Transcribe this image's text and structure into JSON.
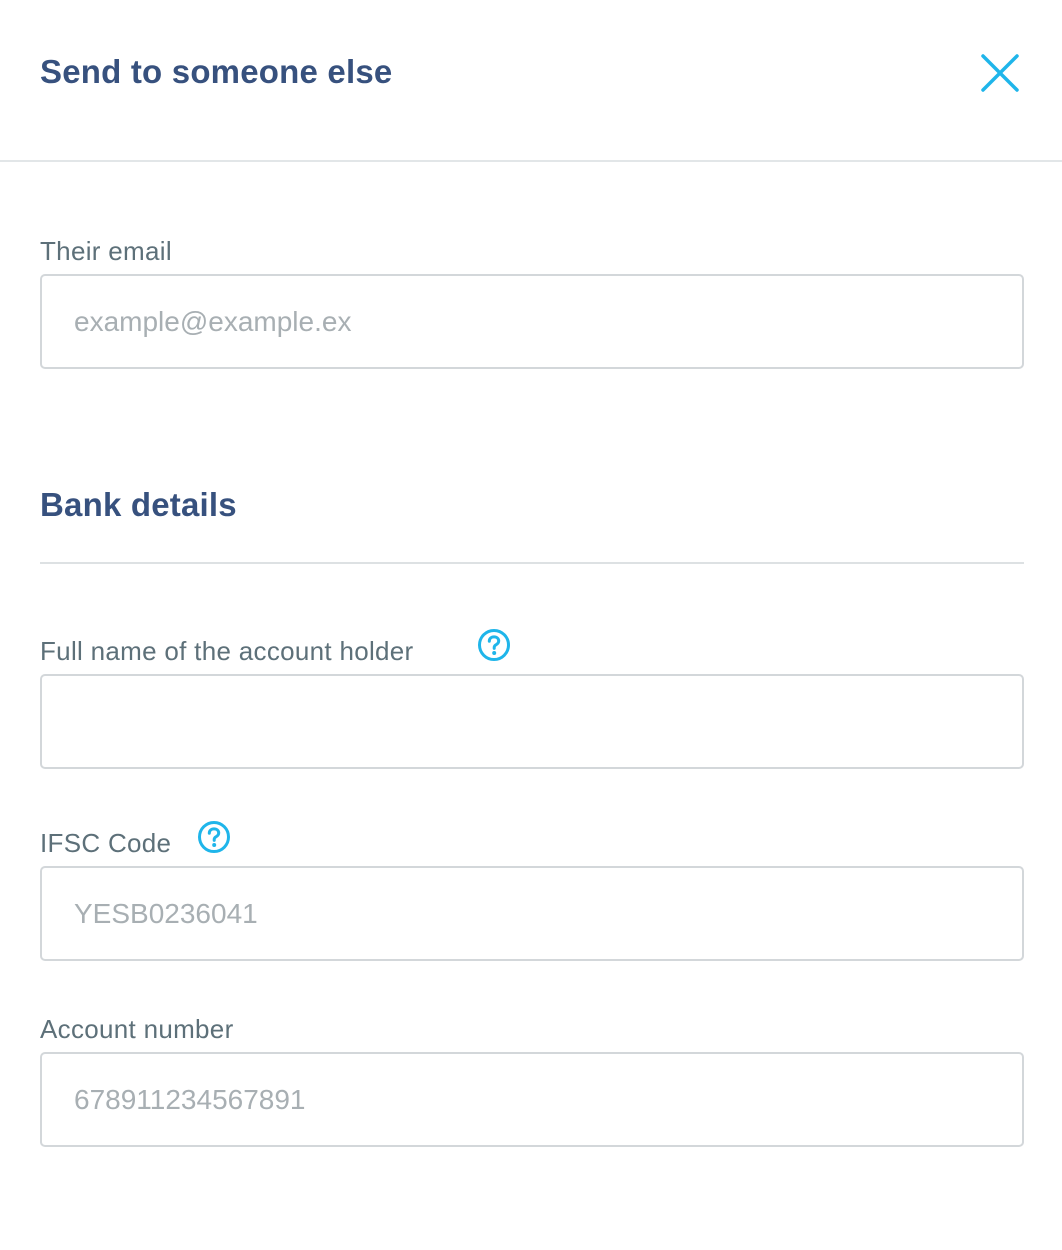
{
  "header": {
    "title": "Send to someone else",
    "close_icon": "close-icon"
  },
  "email": {
    "label": "Their email",
    "placeholder": "example@example.ex",
    "value": ""
  },
  "bank_details": {
    "title": "Bank details",
    "account_holder": {
      "label": "Full name of the account holder",
      "help_icon": "help-question-icon",
      "placeholder": "",
      "value": ""
    },
    "ifsc": {
      "label": "IFSC Code",
      "help_icon": "help-question-icon",
      "placeholder": "YESB0236041",
      "value": ""
    },
    "account_number": {
      "label": "Account number",
      "placeholder": "678911234567891",
      "value": ""
    }
  },
  "colors": {
    "accent": "#1fb5ea",
    "heading": "#37517e",
    "label": "#5d7079",
    "placeholder": "#a8afb3",
    "border": "#d3d7da"
  }
}
